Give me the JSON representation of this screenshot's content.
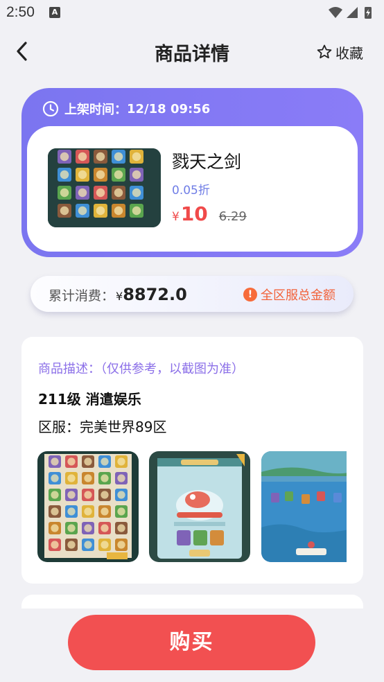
{
  "status_bar": {
    "time": "2:50",
    "app_icon_letter": "A"
  },
  "header": {
    "title": "商品详情",
    "favorite_label": "收藏"
  },
  "listing": {
    "time_label": "上架时间：",
    "time_value": "12/18 09:56",
    "product_name": "戮天之剑",
    "discount": "0.05折",
    "price_symbol": "¥",
    "price": "10",
    "original_price": "6.29"
  },
  "spend": {
    "label": "累计消费：",
    "currency": "¥",
    "value": "8872.0",
    "info_label": "全区服总金额"
  },
  "description": {
    "title": "商品描述：（仅供参考，以截图为准）",
    "level": "211级 消遣娱乐",
    "server": "区服：完美世界89区"
  },
  "buy_button": {
    "label": "购买"
  },
  "colors": {
    "accent": "#7b75f0",
    "price_red": "#f04a4a",
    "buy_red": "#f25051",
    "warning_orange": "#f76b3a",
    "description_purple": "#8b6fe8"
  }
}
